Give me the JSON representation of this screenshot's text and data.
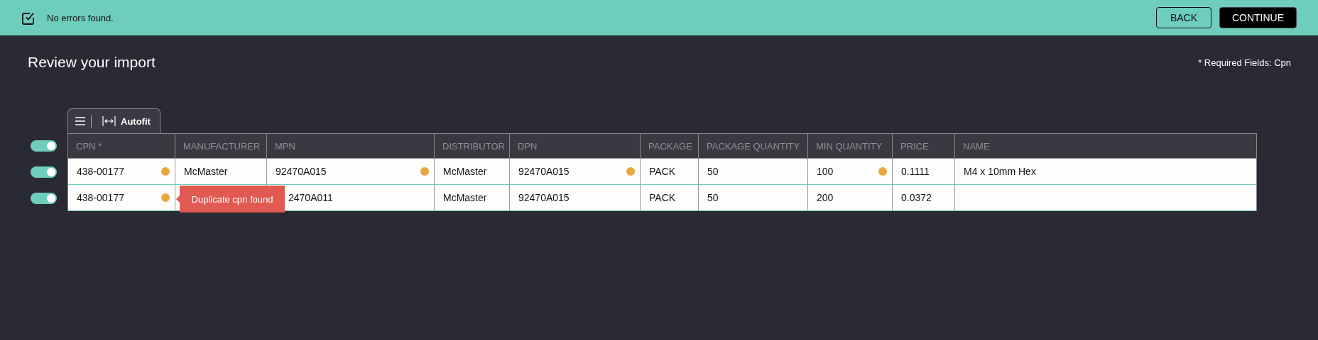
{
  "status_bar": {
    "message": "No errors found.",
    "buttons": [
      {
        "label": "BACK",
        "kind": "outline"
      },
      {
        "label": "CONTINUE",
        "kind": "primary"
      }
    ]
  },
  "page": {
    "title": "Review your import",
    "required_note": "* Required Fields: Cpn"
  },
  "toolbar": {
    "autofit_label": "Autofit"
  },
  "table": {
    "select_all": {
      "on": true
    },
    "columns": [
      "CPN *",
      "MANUFACTURER",
      "MPN",
      "DISTRIBUTOR",
      "DPN",
      "PACKAGE",
      "PACKAGE QUANTITY",
      "MIN QUANTITY",
      "PRICE",
      "NAME"
    ],
    "rows": [
      {
        "on": true,
        "cells": [
          {
            "text": "438-00177",
            "warning": true
          },
          {
            "text": "McMaster",
            "warning": false
          },
          {
            "text": "92470A015",
            "warning": true
          },
          {
            "text": "McMaster",
            "warning": false
          },
          {
            "text": "92470A015",
            "warning": true
          },
          {
            "text": "PACK",
            "warning": false
          },
          {
            "text": "50",
            "warning": false
          },
          {
            "text": "100",
            "warning": true
          },
          {
            "text": "0.1111",
            "warning": false
          },
          {
            "text": "M4 x 10mm Hex",
            "warning": false
          }
        ]
      },
      {
        "on": true,
        "tooltip": "Duplicate cpn found",
        "cells": [
          {
            "text": "438-00177",
            "warning": true
          },
          {
            "warning": false
          },
          {
            "text": "2470A011",
            "warning": false
          },
          {
            "text": "McMaster",
            "warning": false
          },
          {
            "text": "92470A015",
            "warning": false
          },
          {
            "text": "PACK",
            "warning": false
          },
          {
            "text": "50",
            "warning": false
          },
          {
            "text": "200",
            "warning": false
          },
          {
            "text": "0.0372",
            "warning": false
          },
          {
            "warning": false
          }
        ]
      }
    ]
  }
}
